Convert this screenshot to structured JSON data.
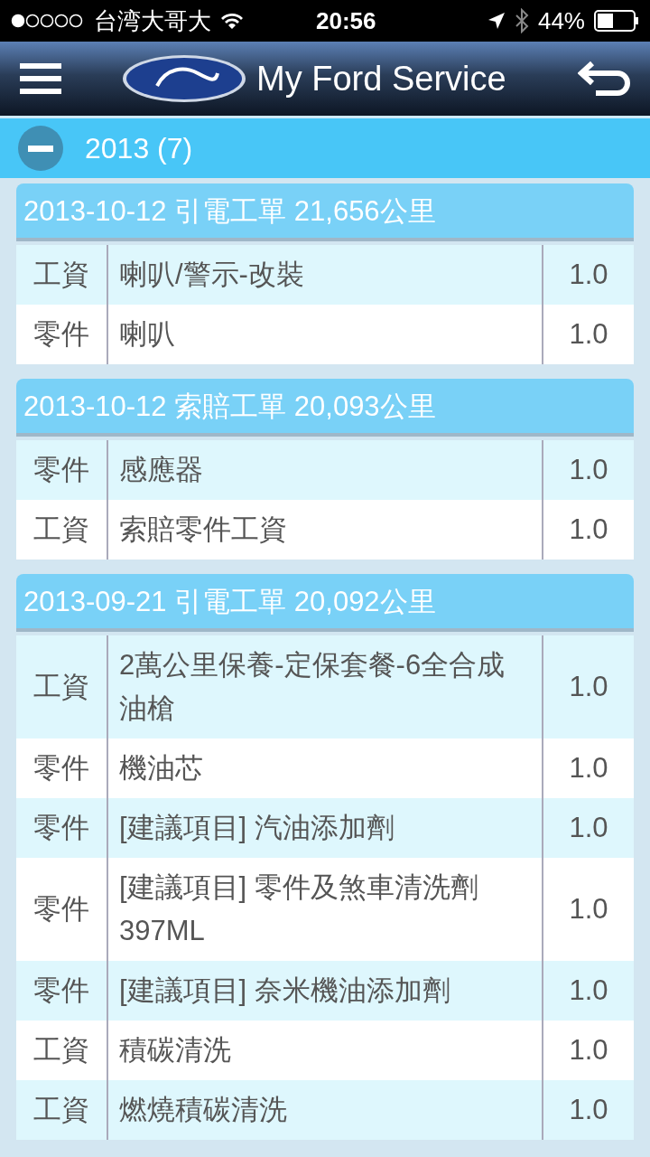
{
  "status_bar": {
    "carrier": "台湾大哥大",
    "time": "20:56",
    "battery": "44%"
  },
  "header": {
    "title": "My Ford Service"
  },
  "group": {
    "title": "2013 (7)",
    "expanded": true
  },
  "orders": [
    {
      "title": "2013-10-12 引電工單 21,656公里",
      "rows": [
        {
          "type": "工資",
          "item": "喇叭/警示-改裝",
          "qty": "1.0"
        },
        {
          "type": "零件",
          "item": "喇叭",
          "qty": "1.0"
        }
      ]
    },
    {
      "title": "2013-10-12 索賠工單 20,093公里",
      "rows": [
        {
          "type": "零件",
          "item": "感應器",
          "qty": "1.0"
        },
        {
          "type": "工資",
          "item": "索賠零件工資",
          "qty": "1.0"
        }
      ]
    },
    {
      "title": "2013-09-21 引電工單 20,092公里",
      "rows": [
        {
          "type": "工資",
          "item": "2萬公里保養-定保套餐-6全合成油槍",
          "qty": "1.0"
        },
        {
          "type": "零件",
          "item": "機油芯",
          "qty": "1.0"
        },
        {
          "type": "零件",
          "item": "[建議項目] 汽油添加劑",
          "qty": "1.0"
        },
        {
          "type": "零件",
          "item": "[建議項目] 零件及煞車清洗劑397ML",
          "qty": "1.0"
        },
        {
          "type": "零件",
          "item": "[建議項目] 奈米機油添加劑",
          "qty": "1.0"
        },
        {
          "type": "工資",
          "item": "積碳清洗",
          "qty": "1.0"
        },
        {
          "type": "工資",
          "item": "燃燒積碳清洗",
          "qty": "1.0"
        }
      ]
    }
  ]
}
